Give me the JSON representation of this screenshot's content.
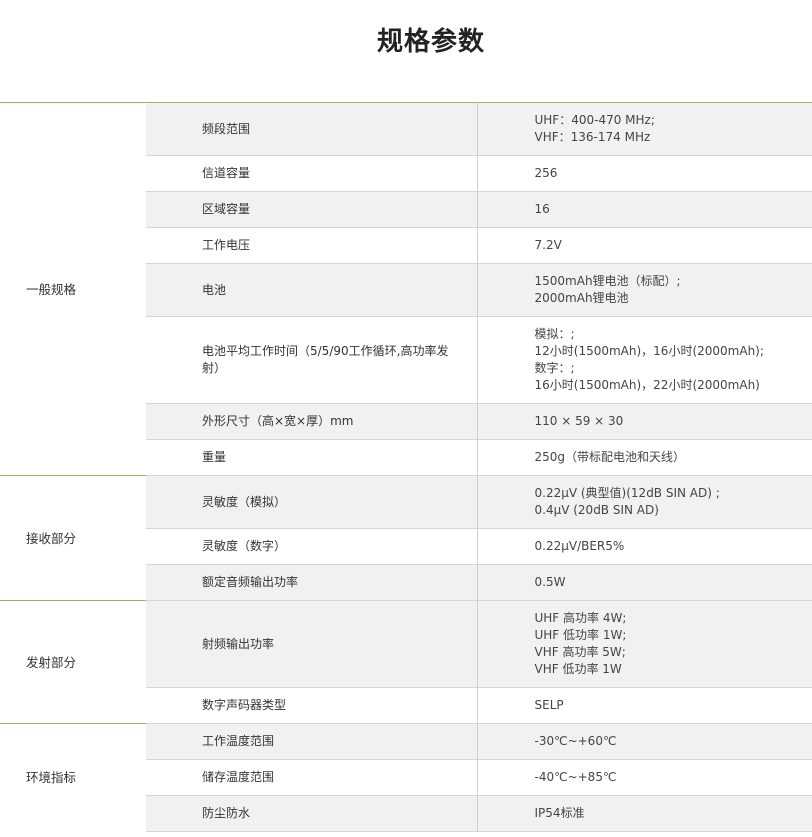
{
  "title": "规格参数",
  "groups": [
    {
      "name": "一般规格",
      "rows": [
        {
          "label": "频段范围",
          "values": [
            "UHF：400-470 MHz;",
            "VHF：136-174 MHz"
          ]
        },
        {
          "label": "信道容量",
          "values": [
            "256"
          ]
        },
        {
          "label": "区域容量",
          "values": [
            "16"
          ]
        },
        {
          "label": "工作电压",
          "values": [
            "7.2V"
          ]
        },
        {
          "label": "电池",
          "values": [
            "1500mAh锂电池（标配）;",
            "2000mAh锂电池"
          ]
        },
        {
          "label": "电池平均工作时间（5/5/90工作循环,高功率发射）",
          "values": [
            "模拟：;",
            "12小时(1500mAh)，16小时(2000mAh);",
            "数字：;",
            "16小时(1500mAh)，22小时(2000mAh)"
          ]
        },
        {
          "label": "外形尺寸（高×宽×厚）mm",
          "values": [
            "110 × 59 × 30"
          ]
        },
        {
          "label": "重量",
          "values": [
            "250g（带标配电池和天线）"
          ]
        }
      ]
    },
    {
      "name": "接收部分",
      "rows": [
        {
          "label": "灵敏度（模拟）",
          "values": [
            "0.22μV (典型值)(12dB SIN AD) ;",
            "0.4μV (20dB SIN AD)"
          ]
        },
        {
          "label": "灵敏度（数字）",
          "values": [
            "0.22μV/BER5%"
          ]
        },
        {
          "label": "额定音频输出功率",
          "values": [
            "0.5W"
          ]
        }
      ]
    },
    {
      "name": "发射部分",
      "rows": [
        {
          "label": "射频输出功率",
          "values": [
            "UHF 高功率 4W;",
            "UHF 低功率 1W;",
            "VHF 高功率 5W;",
            "VHF 低功率 1W"
          ]
        },
        {
          "label": "数字声码器类型",
          "values": [
            "SELP"
          ]
        }
      ]
    },
    {
      "name": "环境指标",
      "rows": [
        {
          "label": "工作温度范围",
          "values": [
            "-30℃~+60℃"
          ]
        },
        {
          "label": "储存温度范围",
          "values": [
            "-40℃~+85℃"
          ]
        },
        {
          "label": "防尘防水",
          "values": [
            "IP54标准"
          ]
        }
      ]
    }
  ]
}
